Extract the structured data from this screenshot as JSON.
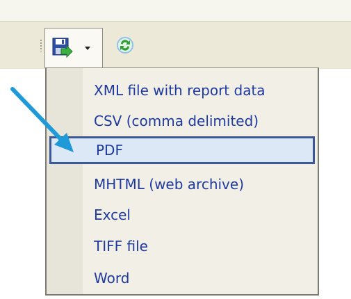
{
  "toolbar": {
    "export_icon": "save-export-icon",
    "refresh_icon": "refresh-icon"
  },
  "export_menu": {
    "items": [
      {
        "label": "XML file with report data"
      },
      {
        "label": "CSV (comma delimited)"
      },
      {
        "label": "PDF"
      },
      {
        "label": "MHTML (web archive)"
      },
      {
        "label": "Excel"
      },
      {
        "label": "TIFF file"
      },
      {
        "label": "Word"
      }
    ],
    "highlighted_item": "PDF"
  },
  "colors": {
    "menu_text": "#1e3a9e",
    "highlight_fill": "#dce8f5",
    "highlight_border": "#3b5998",
    "pointer_arrow": "#1f9ad9"
  }
}
